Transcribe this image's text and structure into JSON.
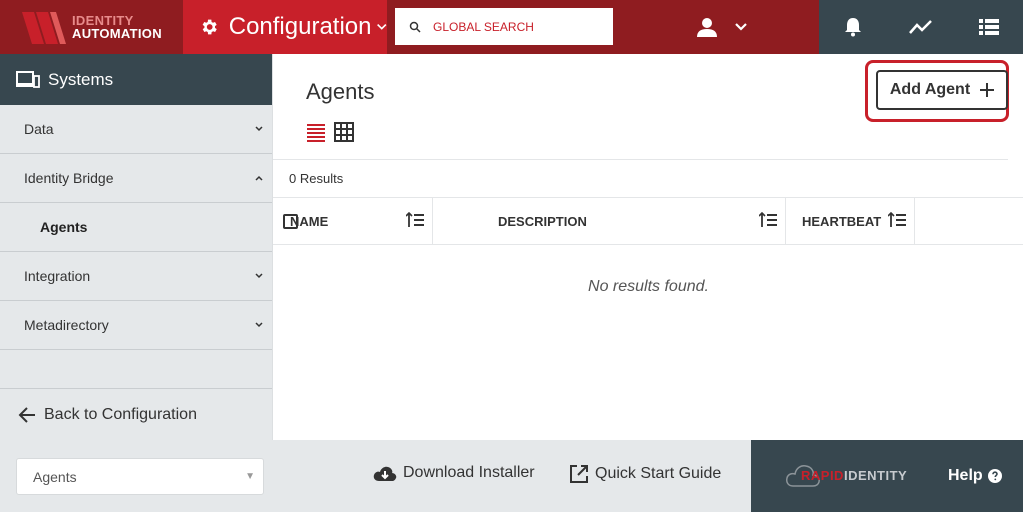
{
  "header": {
    "logo_line1": "IDENTITY",
    "logo_line2": "AUTOMATION",
    "module_title": "Configuration",
    "search_placeholder": "GLOBAL SEARCH"
  },
  "sidebar": {
    "title": "Systems",
    "items": [
      {
        "label": "Data",
        "expanded": false
      },
      {
        "label": "Identity Bridge",
        "expanded": true
      },
      {
        "label": "Agents",
        "selected": true
      },
      {
        "label": "Integration",
        "expanded": false
      },
      {
        "label": "Metadirectory",
        "expanded": false
      }
    ],
    "back_label": "Back to Configuration"
  },
  "main": {
    "title": "Agents",
    "add_button_label": "Add Agent",
    "results_count": "0 Results",
    "columns": [
      "NAME",
      "DESCRIPTION",
      "HEARTBEAT"
    ],
    "empty_message": "No results found."
  },
  "footer": {
    "select_value": "Agents",
    "download_label": "Download Installer",
    "quickstart_label": "Quick Start Guide",
    "brand_part1": "RAPID",
    "brand_part2": "IDENTITY",
    "help_label": "Help"
  },
  "colors": {
    "brand_red": "#c8202a",
    "brand_dark_red": "#8f1c20",
    "slate": "#37474f",
    "panel_gray": "#e5e8ea"
  }
}
